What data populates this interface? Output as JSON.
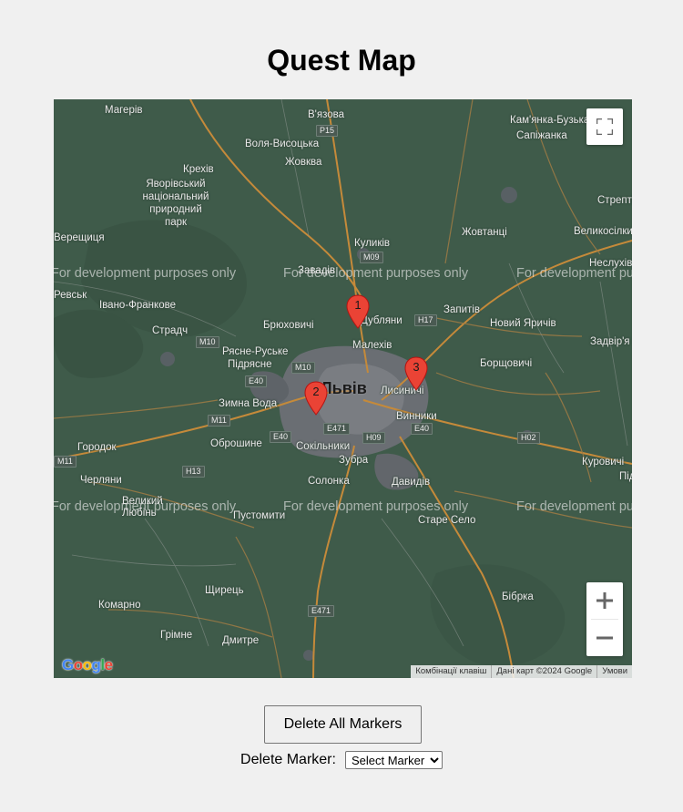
{
  "page": {
    "title": "Quest Map"
  },
  "map": {
    "city_label": "Львів",
    "places": [
      "Магерів",
      "В'язова",
      "Кам'янка-Бузька",
      "Сапіжанка",
      "Воля-Висоцька",
      "Жовква",
      "Крехів",
      "Яворівський",
      "національний",
      "природний",
      "парк",
      "Верещиця",
      "Стрептів",
      "Великосілки",
      "Жовтанці",
      "Куликів",
      "Неслухів",
      "Завадів",
      "Запитів",
      "Івано-Франкове",
      "Брюховичі",
      "Дубляни",
      "Новий Яричів",
      "Страдч",
      "Малехів",
      "Задвір'я",
      "Рясне-Руське",
      "Підрясне",
      "Борщовичі",
      "Зимна Вода",
      "Лисиничі",
      "Винники",
      "Городок",
      "Оброшине",
      "Сокільники",
      "Зубра",
      "Черляни",
      "Солонка",
      "Давидів",
      "Куровичі",
      "Великий",
      "Любінь",
      "Пустомити",
      "Старе Село",
      "Щирець",
      "Бібрка",
      "Комарно",
      "Грімне",
      "Дмитре",
      "Ревськ",
      "Підберізці"
    ],
    "roads": [
      "P15",
      "M09",
      "M10",
      "M10",
      "H17",
      "E40",
      "E40",
      "M11",
      "E471",
      "H09",
      "E40",
      "H02",
      "M11",
      "H13",
      "E471"
    ],
    "watermark": "For development purposes only",
    "markers": [
      {
        "label": "1",
        "color": "#ea4335"
      },
      {
        "label": "2",
        "color": "#ea4335"
      },
      {
        "label": "3",
        "color": "#ea4335"
      }
    ],
    "attribution": {
      "shortcuts": "Комбінації клавіш",
      "data": "Дані карт ©2024 Google",
      "terms": "Умови"
    },
    "logo": "Google",
    "controls": {
      "fullscreen_icon": "fullscreen-icon",
      "zoom_in_icon": "plus-icon",
      "zoom_out_icon": "minus-icon"
    }
  },
  "controls": {
    "delete_all_label": "Delete All Markers",
    "delete_marker_label": "Delete Marker:",
    "select_selected": "Select Marker"
  },
  "colors": {
    "map_bg": "#3f5b4a",
    "marker": "#ea4335",
    "page_bg": "#f0f0f0"
  }
}
